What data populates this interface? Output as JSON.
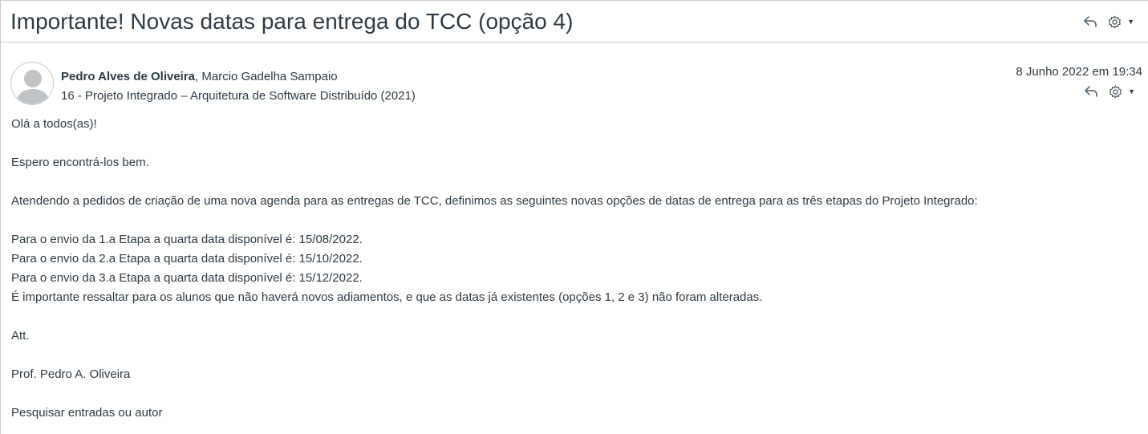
{
  "header": {
    "title": "Importante! Novas datas para entrega do TCC (opção 4)",
    "reply_icon": "reply-icon",
    "settings_icon": "gear-icon",
    "caret_icon": "caret-down-icon"
  },
  "message": {
    "author_primary": "Pedro Alves de Oliveira",
    "author_separator": ", ",
    "author_secondary": "Marcio Gadelha Sampaio",
    "course": "16 - Projeto Integrado – Arquitetura de Software Distribuído (2021)",
    "timestamp": "8 Junho 2022 em 19:34",
    "avatar_icon": "avatar-placeholder-icon",
    "body": {
      "greeting": "Olá a todos(as)!",
      "wish": "Espero encontrá-los bem.",
      "intro": "Atendendo a pedidos de criação de uma nova agenda para as entregas de TCC, definimos as seguintes novas opções de datas de entrega para as três etapas do Projeto Integrado:",
      "stage1": "Para o envio da 1.a Etapa a quarta data disponível é: 15/08/2022.",
      "stage2": "Para o envio da 2.a Etapa a quarta data disponível é: 15/10/2022.",
      "stage3": "Para o envio da 3.a Etapa a quarta data disponível é: 15/12/2022.",
      "note": "É importante ressaltar para os alunos que não haverá novos adiamentos, e que as datas já existentes (opções 1, 2 e 3) não foram alteradas.",
      "closing": "Att.",
      "signature": "Prof. Pedro A. Oliveira",
      "search_hint": "Pesquisar entradas ou autor"
    }
  },
  "colors": {
    "text": "#2d3b45",
    "border": "#c7cdd1",
    "icon": "#4a5a65",
    "avatar": "#bfc4c8"
  }
}
